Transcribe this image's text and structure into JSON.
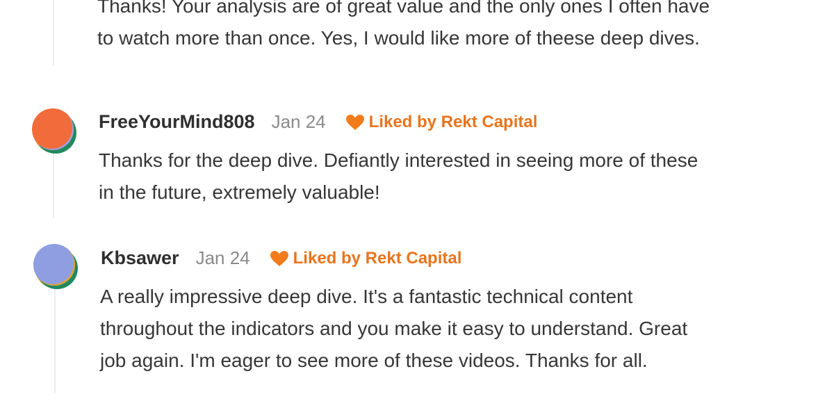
{
  "comments": [
    {
      "text_lines": [
        "Thanks! Your analysis are of great value and the only ones I often have",
        "to watch more than once. Yes, I would like more of theese deep dives."
      ]
    },
    {
      "author": "FreeYourMind808",
      "date": "Jan 24",
      "liked_label": "Liked by Rekt Capital",
      "avatar_color": "#f26b3a",
      "text_lines": [
        "Thanks for the deep dive. Defiantly interested in seeing more of these",
        "in the future, extremely valuable!"
      ]
    },
    {
      "author": "Kbsawer",
      "date": "Jan 24",
      "liked_label": "Liked by Rekt Capital",
      "avatar_color": "#8e9ee0",
      "text_lines": [
        "A really impressive deep dive. It's a fantastic technical content",
        "throughout the indicators and you make it easy to understand. Great",
        "job again. I'm eager to see more of these videos. Thanks for all."
      ]
    }
  ],
  "colors": {
    "accent": "#e8741c",
    "thread_line": "#ececec"
  }
}
